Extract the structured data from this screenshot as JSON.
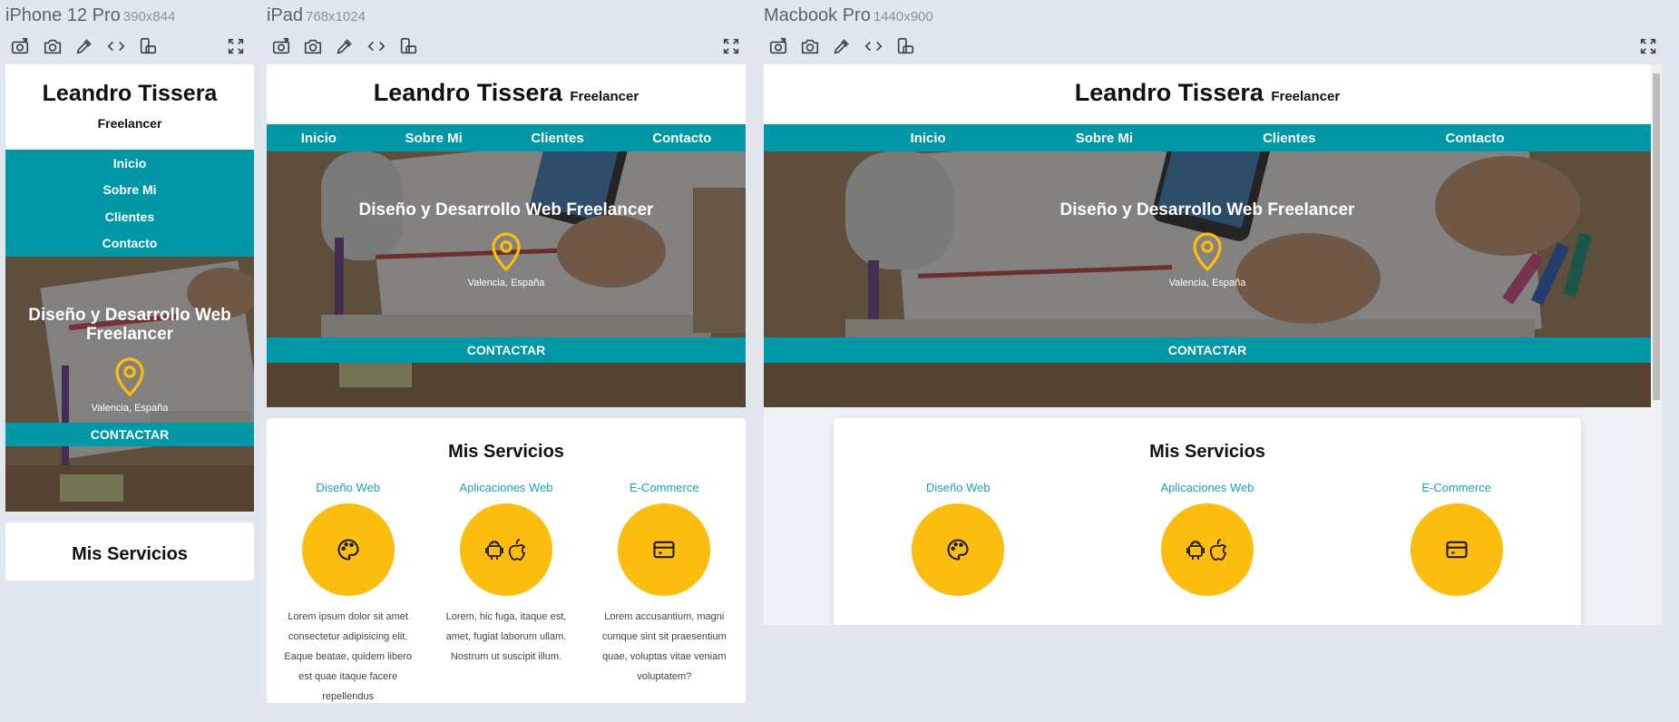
{
  "devices": {
    "iphone": {
      "name": "iPhone 12 Pro",
      "dims": "390x844"
    },
    "ipad": {
      "name": "iPad",
      "dims": "768x1024"
    },
    "macbook": {
      "name": "Macbook Pro",
      "dims": "1440x900"
    }
  },
  "toolbar_icons": [
    "camera-rotate-icon",
    "camera-icon",
    "eyedropper-icon",
    "code-icon",
    "device-rotate-icon",
    "fullscreen-icon"
  ],
  "site": {
    "name": "Leandro Tissera",
    "role": "Freelancer",
    "nav": [
      "Inicio",
      "Sobre Mi",
      "Clientes",
      "Contacto"
    ],
    "hero_title": "Diseño y Desarrollo Web Freelancer",
    "location": "Valencia, España",
    "cta": "CONTACTAR",
    "services_title": "Mis Servicios",
    "services": [
      {
        "name": "Diseño Web",
        "icon": "palette-icon",
        "text": "Lorem ipsum dolor sit amet consectetur adipisicing elit. Eaque beatae, quidem libero est quae itaque facere repellendus"
      },
      {
        "name": "Aplicaciones Web",
        "icon": "android-apple-icon",
        "text": "Lorem, hic fuga, itaque est, amet, fugiat laborum ullam. Nostrum ut suscipit illum."
      },
      {
        "name": "E-Commerce",
        "icon": "credit-card-icon",
        "text": "Lorem accusantium, magni cumque sint sit praesentium quae, voluptas vitae veniam voluptatem?"
      }
    ]
  },
  "colors": {
    "teal": "#0097a7",
    "yellow": "#fcbd0f",
    "service_link": "#1aa3b4",
    "canvas": "#e2e7ef"
  }
}
